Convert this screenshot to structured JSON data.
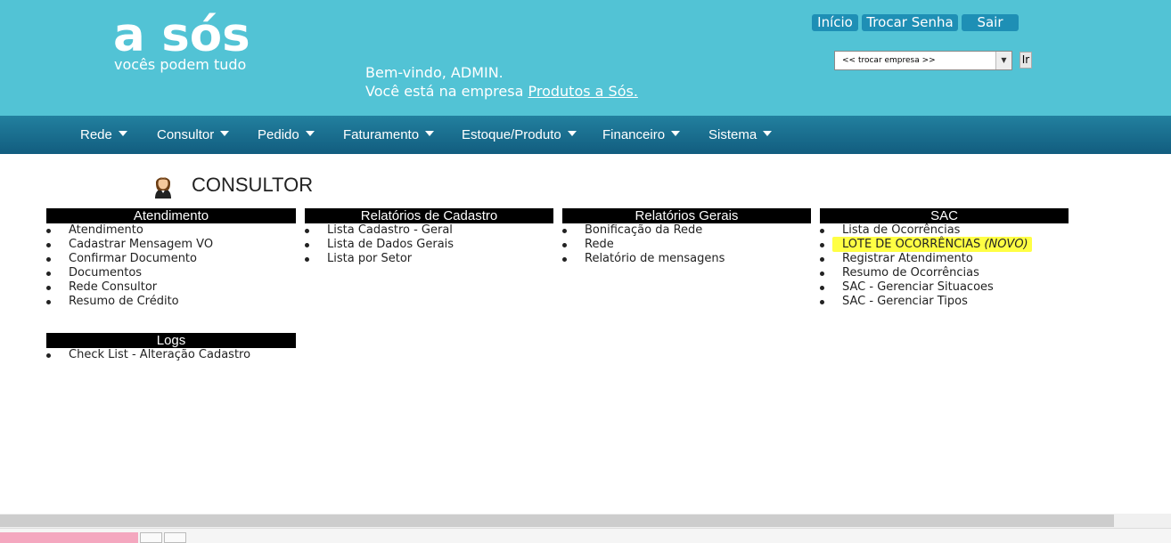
{
  "header": {
    "logo_main": "a sós",
    "logo_sub": "vocês podem tudo",
    "welcome_line1": "Bem-vindo, ADMIN.",
    "welcome_line2_prefix": "Você está na empresa ",
    "company_link": "Produtos a Sós.",
    "buttons": {
      "inicio": "Início",
      "trocar_senha": "Trocar Senha",
      "sair": "Sair"
    },
    "company_select": {
      "selected": "<< trocar empresa >>"
    },
    "ir_button": "Ir"
  },
  "nav": {
    "items": [
      {
        "label": "Rede"
      },
      {
        "label": "Consultor"
      },
      {
        "label": "Pedido"
      },
      {
        "label": "Faturamento"
      },
      {
        "label": "Estoque/Produto"
      },
      {
        "label": "Financeiro"
      },
      {
        "label": "Sistema"
      }
    ]
  },
  "page": {
    "title": "CONSULTOR",
    "icon": "consultant-avatar-icon"
  },
  "panels": {
    "atendimento": {
      "title": "Atendimento",
      "items": [
        "Atendimento",
        "Cadastrar Mensagem VO",
        "Confirmar Documento",
        "Documentos",
        "Rede Consultor",
        "Resumo de Crédito"
      ]
    },
    "relatorios_cadastro": {
      "title": "Relatórios de Cadastro",
      "items": [
        "Lista Cadastro - Geral",
        "Lista de Dados Gerais",
        "Lista por Setor"
      ]
    },
    "relatorios_gerais": {
      "title": "Relatórios Gerais",
      "items": [
        "Bonificação da Rede",
        "Rede",
        "Relatório de mensagens"
      ]
    },
    "sac": {
      "title": "SAC",
      "items": [
        "Lista de Ocorrências",
        "LOTE DE OCORRÊNCIAS",
        "Registrar Atendimento",
        "Resumo de Ocorrências",
        "SAC - Gerenciar Situacoes",
        "SAC - Gerenciar Tipos"
      ],
      "new_badge": "(NOVO)"
    },
    "logs": {
      "title": "Logs",
      "items": [
        "Check List - Alteração Cadastro"
      ]
    }
  },
  "colors": {
    "header_bg": "#52c3d5",
    "nav_bg": "#1a6f90",
    "button_bg": "#1e8fb5",
    "highlight": "#ffff44"
  }
}
